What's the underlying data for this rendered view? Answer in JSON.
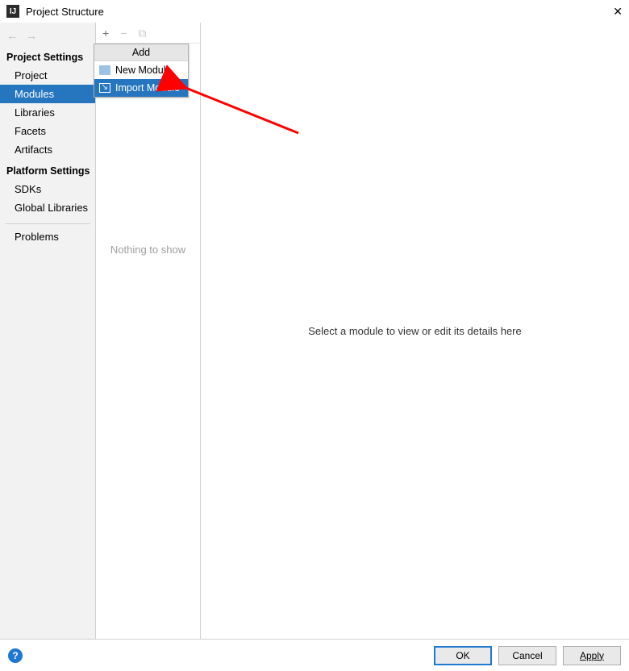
{
  "window": {
    "title": "Project Structure"
  },
  "sidebar": {
    "nav_back": "←",
    "nav_forward": "→",
    "sections": {
      "project_settings": {
        "header": "Project Settings",
        "items": [
          "Project",
          "Modules",
          "Libraries",
          "Facets",
          "Artifacts"
        ],
        "selected_index": 1
      },
      "platform_settings": {
        "header": "Platform Settings",
        "items": [
          "SDKs",
          "Global Libraries"
        ]
      },
      "problems": {
        "items": [
          "Problems"
        ]
      }
    }
  },
  "modules_panel": {
    "toolbar": {
      "add": "+",
      "remove": "−",
      "copy": "⧉"
    },
    "empty_text": "Nothing to show"
  },
  "popup": {
    "header": "Add",
    "items": [
      {
        "label": "New Module",
        "icon": "folder-icon"
      },
      {
        "label": "Import Module",
        "icon": "import-icon"
      }
    ],
    "selected_index": 1
  },
  "main": {
    "placeholder": "Select a module to view or edit its details here"
  },
  "footer": {
    "ok": "OK",
    "cancel": "Cancel",
    "apply": "Apply"
  },
  "annotation": {
    "arrow_color": "#ff0000"
  }
}
